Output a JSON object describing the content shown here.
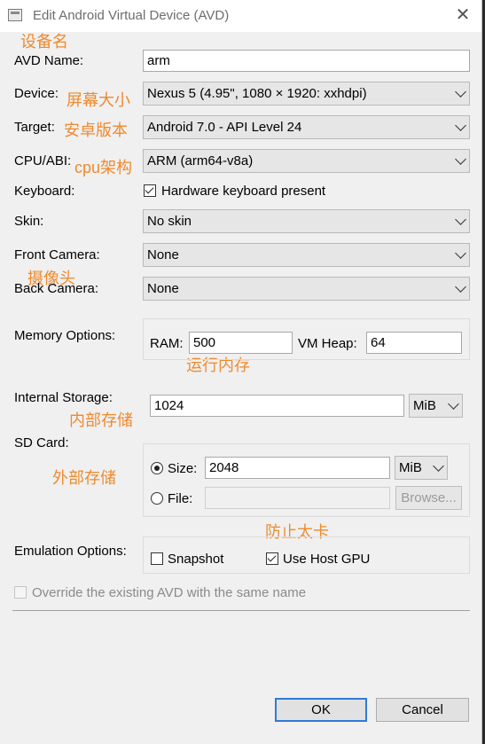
{
  "window": {
    "title": "Edit Android Virtual Device (AVD)",
    "close": "✕"
  },
  "annotations": {
    "device_name": "设备名",
    "screen_size": "屏幕大小",
    "android_version": "安卓版本",
    "cpu_arch": "cpu架构",
    "camera": "摄像头",
    "ram": "运行内存",
    "internal_storage": "内部存储",
    "external_storage": "外部存储",
    "prevent_lag": "防止太卡"
  },
  "form": {
    "avd_name": {
      "label": "AVD Name:",
      "value": "arm"
    },
    "device": {
      "label": "Device:",
      "value": "Nexus 5 (4.95\", 1080 × 1920: xxhdpi)"
    },
    "target": {
      "label": "Target:",
      "value": "Android 7.0 - API Level 24"
    },
    "cpu_abi": {
      "label": "CPU/ABI:",
      "value": "ARM (arm64-v8a)"
    },
    "keyboard": {
      "label": "Keyboard:",
      "checkbox_label": "Hardware keyboard present",
      "checked": true
    },
    "skin": {
      "label": "Skin:",
      "value": "No skin"
    },
    "front_camera": {
      "label": "Front Camera:",
      "value": "None"
    },
    "back_camera": {
      "label": "Back Camera:",
      "value": "None"
    },
    "memory": {
      "label": "Memory Options:",
      "ram_label": "RAM:",
      "ram_value": "500",
      "vm_heap_label": "VM Heap:",
      "vm_heap_value": "64"
    },
    "internal_storage": {
      "label": "Internal Storage:",
      "value": "1024",
      "unit": "MiB"
    },
    "sd_card": {
      "label": "SD Card:",
      "size_label": "Size:",
      "size_value": "2048",
      "size_unit": "MiB",
      "file_label": "File:",
      "file_value": "",
      "browse_label": "Browse...",
      "selected": "size"
    },
    "emulation": {
      "label": "Emulation Options:",
      "snapshot_label": "Snapshot",
      "snapshot_checked": false,
      "host_gpu_label": "Use Host GPU",
      "host_gpu_checked": true
    },
    "override": {
      "label": "Override the existing AVD with the same name",
      "checked": false
    }
  },
  "buttons": {
    "ok": "OK",
    "cancel": "Cancel"
  }
}
